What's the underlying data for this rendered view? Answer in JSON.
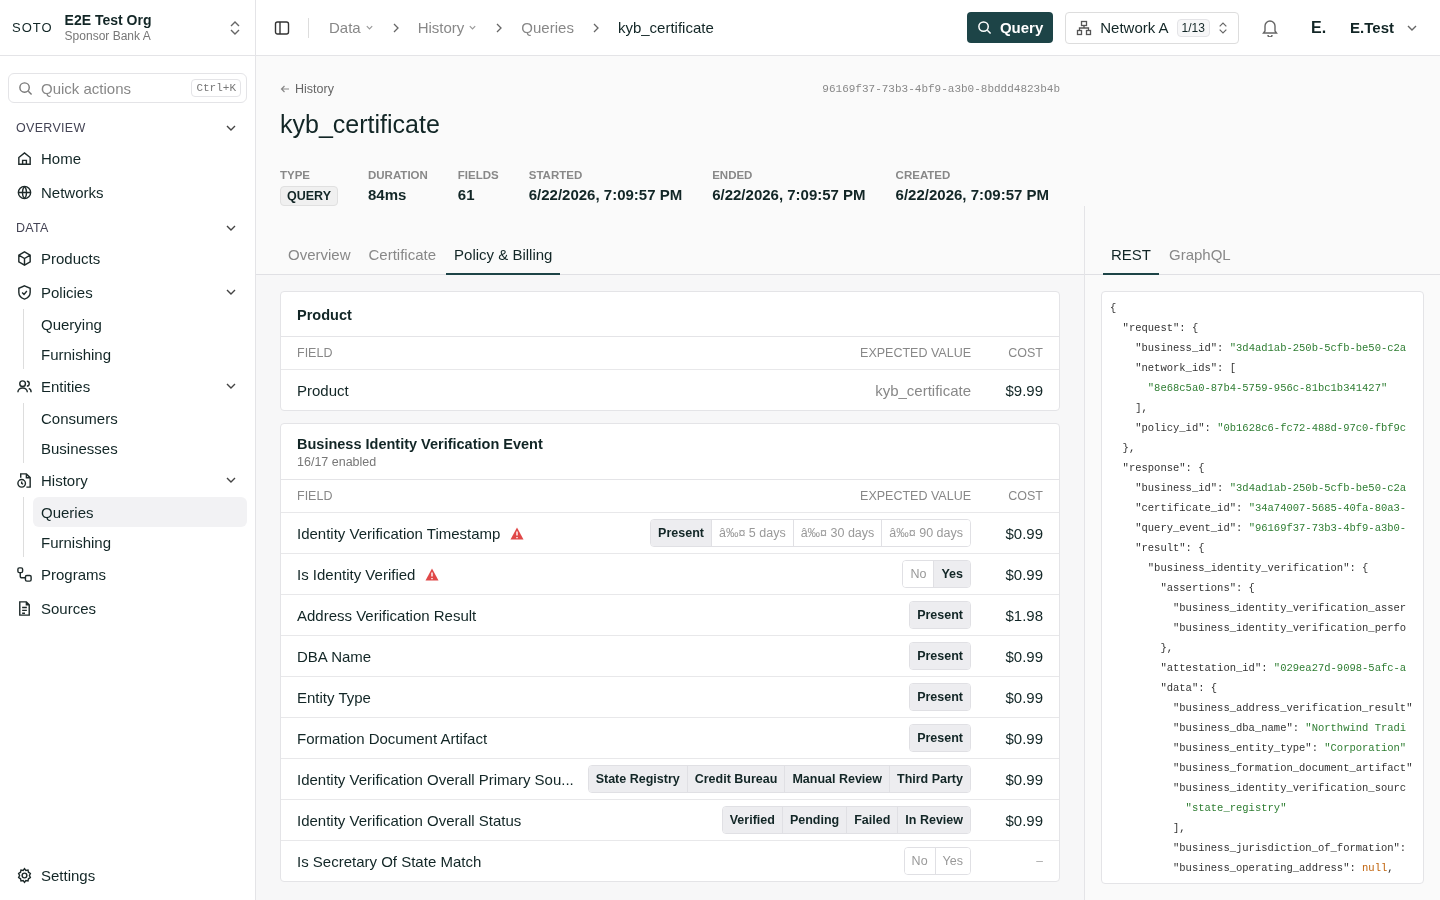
{
  "org": {
    "logo": "SOTO",
    "name": "E2E Test Org",
    "subtitle": "Sponsor Bank A"
  },
  "quick_actions": {
    "placeholder": "Quick actions",
    "shortcut": "Ctrl+K"
  },
  "sidebar": {
    "sections": [
      {
        "title": "OVERVIEW",
        "expanded": true,
        "items": [
          {
            "label": "Home",
            "selected": false
          },
          {
            "label": "Networks",
            "selected": false
          }
        ]
      },
      {
        "title": "DATA",
        "expanded": true,
        "items": [
          {
            "label": "Products",
            "selected": false
          },
          {
            "label": "Policies",
            "selected": false,
            "expanded": true,
            "children": [
              {
                "label": "Querying",
                "selected": false
              },
              {
                "label": "Furnishing",
                "selected": false
              }
            ]
          },
          {
            "label": "Entities",
            "selected": false,
            "expanded": true,
            "children": [
              {
                "label": "Consumers",
                "selected": false
              },
              {
                "label": "Businesses",
                "selected": false
              }
            ]
          },
          {
            "label": "History",
            "selected": false,
            "expanded": true,
            "children": [
              {
                "label": "Queries",
                "selected": true
              },
              {
                "label": "Furnishing",
                "selected": false
              }
            ]
          },
          {
            "label": "Programs",
            "selected": false
          },
          {
            "label": "Sources",
            "selected": false
          }
        ]
      }
    ],
    "footer": {
      "label": "Settings"
    }
  },
  "breadcrumbs": [
    {
      "label": "Data",
      "dropdown": true
    },
    {
      "label": "History",
      "dropdown": true
    },
    {
      "label": "Queries",
      "dropdown": false
    },
    {
      "label": "kyb_certificate",
      "dropdown": false
    }
  ],
  "topbar": {
    "query_button": "Query",
    "network": {
      "label": "Network A",
      "count": "1/13"
    },
    "user": {
      "initials": "E.",
      "name": "E.Test"
    }
  },
  "header": {
    "back": "History",
    "id": "96169f37-73b3-4bf9-a3b0-8bddd4823b4b",
    "title": "kyb_certificate",
    "meta": [
      {
        "label": "TYPE",
        "value": "QUERY",
        "kind": "badge"
      },
      {
        "label": "DURATION",
        "value": "84ms",
        "kind": "text"
      },
      {
        "label": "FIELDS",
        "value": "61",
        "kind": "text"
      },
      {
        "label": "STARTED",
        "value": "6/22/2026, 7:09:57 PM",
        "kind": "text"
      },
      {
        "label": "ENDED",
        "value": "6/22/2026, 7:09:57 PM",
        "kind": "text"
      },
      {
        "label": "CREATED",
        "value": "6/22/2026, 7:09:57 PM",
        "kind": "text"
      }
    ]
  },
  "tabs": [
    {
      "label": "Overview",
      "selected": false
    },
    {
      "label": "Certificate",
      "selected": false
    },
    {
      "label": "Policy & Billing",
      "selected": true
    }
  ],
  "code_tabs": [
    {
      "label": "REST",
      "selected": true
    },
    {
      "label": "GraphQL",
      "selected": false
    }
  ],
  "cards": [
    {
      "title": "Product",
      "columns": [
        "FIELD",
        "EXPECTED VALUE",
        "COST"
      ],
      "rows": [
        {
          "field": "Product",
          "kind": "text",
          "value": "kyb_certificate",
          "cost": "$9.99",
          "warning": false,
          "enabled": true
        }
      ]
    },
    {
      "title": "Business Identity Verification Event",
      "subtitle": "16/17 enabled",
      "columns": [
        "FIELD",
        "EXPECTED VALUE",
        "COST"
      ],
      "rows": [
        {
          "field": "Identity Verification Timestamp",
          "kind": "options",
          "warning": true,
          "enabled": true,
          "cost": "$0.99",
          "options": [
            {
              "label": "Present",
              "selected": true
            },
            {
              "label": "â‰¤ 5 days",
              "selected": false
            },
            {
              "label": "â‰¤ 30 days",
              "selected": false
            },
            {
              "label": "â‰¤ 90 days",
              "selected": false
            }
          ]
        },
        {
          "field": "Is Identity Verified",
          "kind": "options",
          "warning": true,
          "enabled": true,
          "cost": "$0.99",
          "options": [
            {
              "label": "No",
              "selected": false
            },
            {
              "label": "Yes",
              "selected": true
            }
          ]
        },
        {
          "field": "Address Verification Result",
          "kind": "options",
          "warning": false,
          "enabled": true,
          "cost": "$1.98",
          "options": [
            {
              "label": "Present",
              "selected": true
            }
          ]
        },
        {
          "field": "DBA Name",
          "kind": "options",
          "warning": false,
          "enabled": true,
          "cost": "$0.99",
          "options": [
            {
              "label": "Present",
              "selected": true
            }
          ]
        },
        {
          "field": "Entity Type",
          "kind": "options",
          "warning": false,
          "enabled": true,
          "cost": "$0.99",
          "options": [
            {
              "label": "Present",
              "selected": true
            }
          ]
        },
        {
          "field": "Formation Document Artifact",
          "kind": "options",
          "warning": false,
          "enabled": true,
          "cost": "$0.99",
          "options": [
            {
              "label": "Present",
              "selected": true
            }
          ]
        },
        {
          "field": "Identity Verification Overall Primary Sou...",
          "kind": "options",
          "warning": false,
          "enabled": true,
          "cost": "$0.99",
          "options": [
            {
              "label": "State Registry",
              "selected": true
            },
            {
              "label": "Credit Bureau",
              "selected": true
            },
            {
              "label": "Manual Review",
              "selected": true
            },
            {
              "label": "Third Party",
              "selected": true
            }
          ]
        },
        {
          "field": "Identity Verification Overall Status",
          "kind": "options",
          "warning": false,
          "enabled": true,
          "cost": "$0.99",
          "options": [
            {
              "label": "Verified",
              "selected": true
            },
            {
              "label": "Pending",
              "selected": true
            },
            {
              "label": "Failed",
              "selected": true
            },
            {
              "label": "In Review",
              "selected": true
            }
          ]
        },
        {
          "field": "Is Secretary Of State Match",
          "kind": "options",
          "warning": false,
          "enabled": false,
          "cost": "–",
          "options": [
            {
              "label": "No",
              "selected": false
            },
            {
              "label": "Yes",
              "selected": false
            }
          ]
        }
      ]
    }
  ],
  "code": [
    [
      {
        "kind": "punct",
        "text": "{"
      }
    ],
    [
      {
        "kind": "key",
        "text": "  \"request\": {"
      }
    ],
    [
      {
        "kind": "key",
        "text": "    \"business_id\": "
      },
      {
        "kind": "string",
        "text": "\"3d4ad1ab-250b-5cfb-be50-c2a"
      }
    ],
    [
      {
        "kind": "key",
        "text": "    \"network_ids\": ["
      }
    ],
    [
      {
        "kind": "string",
        "text": "      \"8e68c5a0-87b4-5759-956c-81bc1b341427\""
      }
    ],
    [
      {
        "kind": "punct",
        "text": "    ],"
      }
    ],
    [
      {
        "kind": "key",
        "text": "    \"policy_id\": "
      },
      {
        "kind": "string",
        "text": "\"0b1628c6-fc72-488d-97c0-fbf9c"
      }
    ],
    [
      {
        "kind": "punct",
        "text": "  },"
      }
    ],
    [
      {
        "kind": "key",
        "text": "  \"response\": {"
      }
    ],
    [
      {
        "kind": "key",
        "text": "    \"business_id\": "
      },
      {
        "kind": "string",
        "text": "\"3d4ad1ab-250b-5cfb-be50-c2a"
      }
    ],
    [
      {
        "kind": "key",
        "text": "    \"certificate_id\": "
      },
      {
        "kind": "string",
        "text": "\"34a74007-5685-40fa-80a3-"
      }
    ],
    [
      {
        "kind": "key",
        "text": "    \"query_event_id\": "
      },
      {
        "kind": "string",
        "text": "\"96169f37-73b3-4bf9-a3b0-"
      }
    ],
    [
      {
        "kind": "key",
        "text": "    \"result\": {"
      }
    ],
    [
      {
        "kind": "key",
        "text": "      \"business_identity_verification\": {"
      }
    ],
    [
      {
        "kind": "key",
        "text": "        \"assertions\": {"
      }
    ],
    [
      {
        "kind": "key",
        "text": "          \"business_identity_verification_asser"
      }
    ],
    [
      {
        "kind": "key",
        "text": "          \"business_identity_verification_perfo"
      }
    ],
    [
      {
        "kind": "punct",
        "text": "        },"
      }
    ],
    [
      {
        "kind": "key",
        "text": "        \"attestation_id\": "
      },
      {
        "kind": "string",
        "text": "\"029ea27d-9098-5afc-a"
      }
    ],
    [
      {
        "kind": "key",
        "text": "        \"data\": {"
      }
    ],
    [
      {
        "kind": "key",
        "text": "          \"business_address_verification_result\""
      }
    ],
    [
      {
        "kind": "key",
        "text": "          \"business_dba_name\": "
      },
      {
        "kind": "string",
        "text": "\"Northwind Tradi"
      }
    ],
    [
      {
        "kind": "key",
        "text": "          \"business_entity_type\": "
      },
      {
        "kind": "string",
        "text": "\"Corporation\""
      }
    ],
    [
      {
        "kind": "key",
        "text": "          \"business_formation_document_artifact\""
      }
    ],
    [
      {
        "kind": "key",
        "text": "          \"business_identity_verification_sourc"
      }
    ],
    [
      {
        "kind": "string",
        "text": "            \"state_registry\""
      }
    ],
    [
      {
        "kind": "punct",
        "text": "          ],"
      }
    ],
    [
      {
        "kind": "key",
        "text": "          \"business_jurisdiction_of_formation\":"
      }
    ],
    [
      {
        "kind": "key",
        "text": "          \"business_operating_address\": "
      },
      {
        "kind": "null",
        "text": "null"
      },
      {
        "kind": "punct",
        "text": ","
      }
    ]
  ]
}
